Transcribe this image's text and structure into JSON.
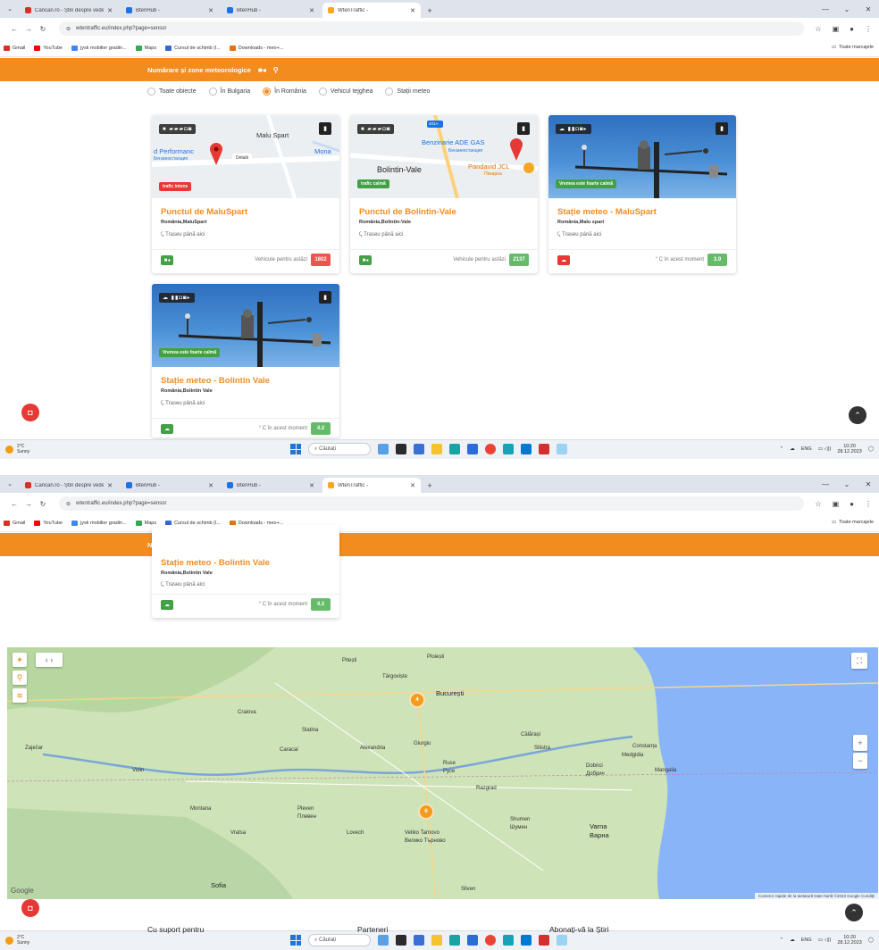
{
  "browser": {
    "tabs": [
      {
        "label": "Cancan.ro - Știri despre vedete",
        "favicon_color": "#d93025",
        "active": false
      },
      {
        "label": "BtenHub -",
        "favicon_color": "#1a73e8",
        "active": false
      },
      {
        "label": "BtenHub -",
        "favicon_color": "#1a73e8",
        "active": false
      },
      {
        "label": "WtenTraffic -",
        "favicon_color": "#f5a623",
        "active": true
      }
    ],
    "url": "wtentraffic.eu/index.php?page=sensor",
    "bookmarks": [
      {
        "label": "Gmail",
        "color": "#d93025"
      },
      {
        "label": "YouTube",
        "color": "#ff0000"
      },
      {
        "label": "jysk mobilier gradin...",
        "color": "#4285f4"
      },
      {
        "label": "Maps",
        "color": "#34a853"
      },
      {
        "label": "Cursul de schimb (l...",
        "color": "#3367d6"
      },
      {
        "label": "Downloads - meo+...",
        "color": "#e8710a"
      }
    ],
    "bookmarks_folder": "Toate marcajele"
  },
  "header": {
    "title": "Numărare și zone meteorologice"
  },
  "filters": [
    {
      "label": "Toate obiecte",
      "selected": false
    },
    {
      "label": "În Bulgaria",
      "selected": false
    },
    {
      "label": "În România",
      "selected": true
    },
    {
      "label": "Vehicul tejghea",
      "selected": false
    },
    {
      "label": "Stații meteo",
      "selected": false
    }
  ],
  "cards": [
    {
      "kind": "map",
      "title": "Punctul de MaluSpart",
      "location": "România,MaluSpart",
      "route_label": "Traseu până aici",
      "status_chip": "trafic intens",
      "status_color": "#e53935",
      "map_labels": [
        "Malu Spart",
        "d Performanc",
        "Бензиностанция",
        "Detalii",
        "Mona"
      ],
      "footer_label": "Vehicule pentru astăzi",
      "footer_value": "1802",
      "value_color": "#ef5350",
      "icon_color": "#43a047"
    },
    {
      "kind": "map",
      "title": "Punctul de Bolintin-Vale",
      "location": "România,Bolintin-Vale",
      "route_label": "Traseu până aici",
      "status_chip": "trafic calmă",
      "status_color": "#43a047",
      "map_labels": [
        "Benzinarie ADE GAS",
        "Бензиностанция",
        "Bolintin-Vale",
        "Pandavid JCL",
        "Пекарна",
        "401A"
      ],
      "footer_label": "Vehicule pentru astăzi",
      "footer_value": "2137",
      "value_color": "#66bb6a",
      "icon_color": "#43a047"
    },
    {
      "kind": "weather",
      "title": "Stație meteo - MaluSpart",
      "location": "România,Malu spart",
      "route_label": "Traseu până aici",
      "status_chip": "Vremea este foarte calmă",
      "status_color": "#43a047",
      "footer_label": "° C în acest moment",
      "footer_value": "3.9",
      "value_color": "#66bb6a",
      "icon_color": "#e53935"
    },
    {
      "kind": "weather",
      "title": "Stație meteo - Bolintin Vale",
      "location": "România,Bolintin Vale",
      "route_label": "Traseu până aici",
      "status_chip": "Vremea este foarte calmă",
      "status_color": "#43a047",
      "footer_label": "° C în acest moment",
      "footer_value": "4.2",
      "value_color": "#66bb6a",
      "icon_color": "#43a047"
    }
  ],
  "map": {
    "labels": [
      {
        "t": "București",
        "big": true
      },
      {
        "t": "Craiova",
        "big": false
      },
      {
        "t": "Pitești",
        "big": false
      },
      {
        "t": "Ruse",
        "big": false
      },
      {
        "t": "Русе",
        "big": false
      },
      {
        "t": "Pleven",
        "big": false
      },
      {
        "t": "Плевен",
        "big": false
      },
      {
        "t": "Veliko Tarnovo",
        "big": false
      },
      {
        "t": "Велико Търново",
        "big": false
      },
      {
        "t": "Varna",
        "big": true
      },
      {
        "t": "Варна",
        "big": true
      },
      {
        "t": "Dobrici",
        "big": false
      },
      {
        "t": "Добрич",
        "big": false
      },
      {
        "t": "Shumen",
        "big": false
      },
      {
        "t": "Шумен",
        "big": false
      },
      {
        "t": "Sofia",
        "big": true
      },
      {
        "t": "Slatina",
        "big": false
      },
      {
        "t": "Giurgiu",
        "big": false
      },
      {
        "t": "Constanța",
        "big": false
      },
      {
        "t": "Sliven",
        "big": false
      },
      {
        "t": "Montana",
        "big": false
      },
      {
        "t": "Vidin",
        "big": false
      },
      {
        "t": "Călărași",
        "big": false
      },
      {
        "t": "Alexandria",
        "big": false
      },
      {
        "t": "Caracal",
        "big": false
      },
      {
        "t": "Razgrad",
        "big": false
      },
      {
        "t": "Silistra",
        "big": false
      },
      {
        "t": "Zaječar",
        "big": false
      },
      {
        "t": "Lovech",
        "big": false
      },
      {
        "t": "Vratsa",
        "big": false
      },
      {
        "t": "Târgoviște",
        "big": false
      },
      {
        "t": "Ploiești",
        "big": false
      },
      {
        "t": "Mangalia",
        "big": false
      },
      {
        "t": "Medgidia",
        "big": false
      }
    ],
    "clusters": [
      "4",
      "6"
    ],
    "attribution": "Comenzi rapide de la tastatură   Date hartă ©2023 Google   Condiții",
    "google": "Google"
  },
  "footer": {
    "col1": "Cu suport pentru",
    "col2": "Parteneri",
    "col3": "Abonați-vă la Știri"
  },
  "taskbar": {
    "temp": "2°C",
    "weather": "Sunny",
    "search": "Căutați",
    "lang": "ENG",
    "time": "10:20",
    "date": "28.12.2023"
  },
  "colors": {
    "accent": "#f28c1e",
    "cluster": "#f29b1d"
  }
}
